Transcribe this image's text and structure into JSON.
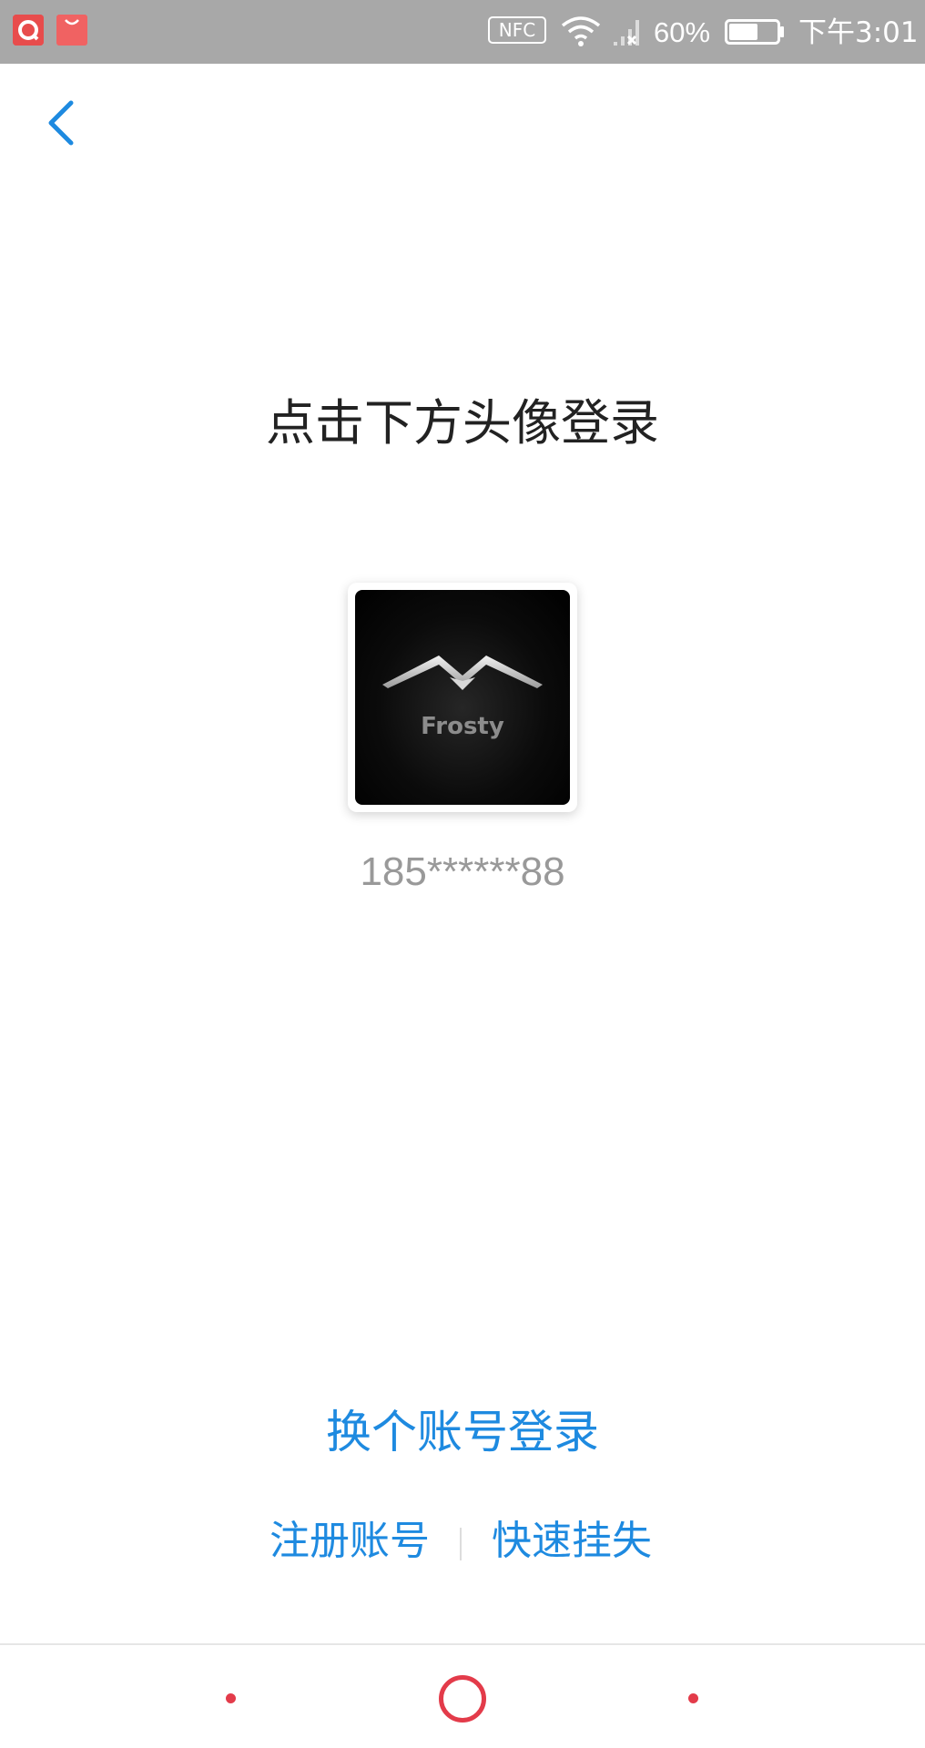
{
  "status_bar": {
    "nfc_label": "NFC",
    "battery_percent": "60%",
    "time": "下午3:01",
    "battery_level": 0.6,
    "icons": [
      "app-icon-red-square",
      "shopping-bag-icon",
      "nfc-icon",
      "wifi-icon",
      "signal-icon",
      "battery-icon"
    ]
  },
  "header": {
    "back_icon": "chevron-left-icon"
  },
  "main": {
    "title": "点击下方头像登录",
    "avatar_logo_text": "Frosty",
    "account_masked": "185******88"
  },
  "links": {
    "switch_account": "换个账号登录",
    "register": "注册账号",
    "report_loss": "快速挂失"
  },
  "nav_bar": {
    "items": [
      "back-dot",
      "home-circle",
      "recents-dot"
    ]
  },
  "colors": {
    "accent_blue": "#1e8ae0",
    "status_bar_bg": "#a8a8a8",
    "nav_red": "#e33b4a"
  }
}
